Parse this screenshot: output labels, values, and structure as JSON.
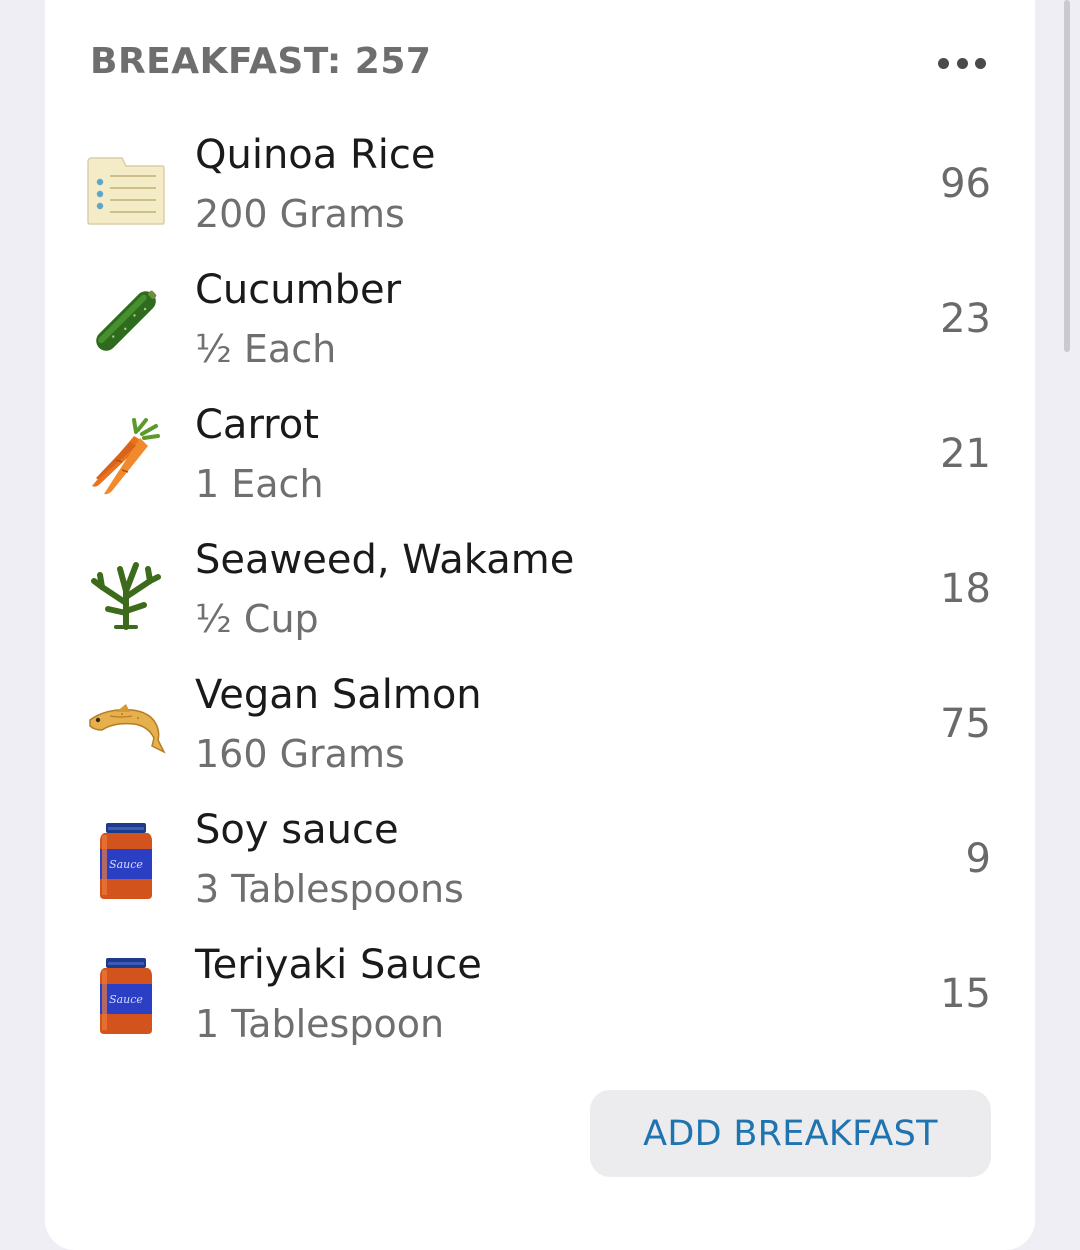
{
  "meal": {
    "title": "BREAKFAST: 257",
    "more_icon": "more-horizontal-icon"
  },
  "items": [
    {
      "name": "Quinoa Rice",
      "amount": "200 Grams",
      "calories": "96",
      "icon": "recipe-card-icon"
    },
    {
      "name": "Cucumber",
      "amount": "½ Each",
      "calories": "23",
      "icon": "cucumber-icon"
    },
    {
      "name": "Carrot",
      "amount": "1 Each",
      "calories": "21",
      "icon": "carrot-icon"
    },
    {
      "name": "Seaweed, Wakame",
      "amount": "½ Cup",
      "calories": "18",
      "icon": "seaweed-icon"
    },
    {
      "name": "Vegan Salmon",
      "amount": "160 Grams",
      "calories": "75",
      "icon": "fish-icon"
    },
    {
      "name": "Soy sauce",
      "amount": "3 Tablespoons",
      "calories": "9",
      "icon": "sauce-jar-icon"
    },
    {
      "name": "Teriyaki Sauce",
      "amount": "1 Tablespoon",
      "calories": "15",
      "icon": "sauce-jar-icon"
    }
  ],
  "icon_text": {
    "sauce_label": "Sauce"
  },
  "add_button": {
    "label": "ADD BREAKFAST"
  },
  "colors": {
    "accent": "#1f74b0",
    "background": "#eeeef4",
    "card": "#ffffff"
  }
}
